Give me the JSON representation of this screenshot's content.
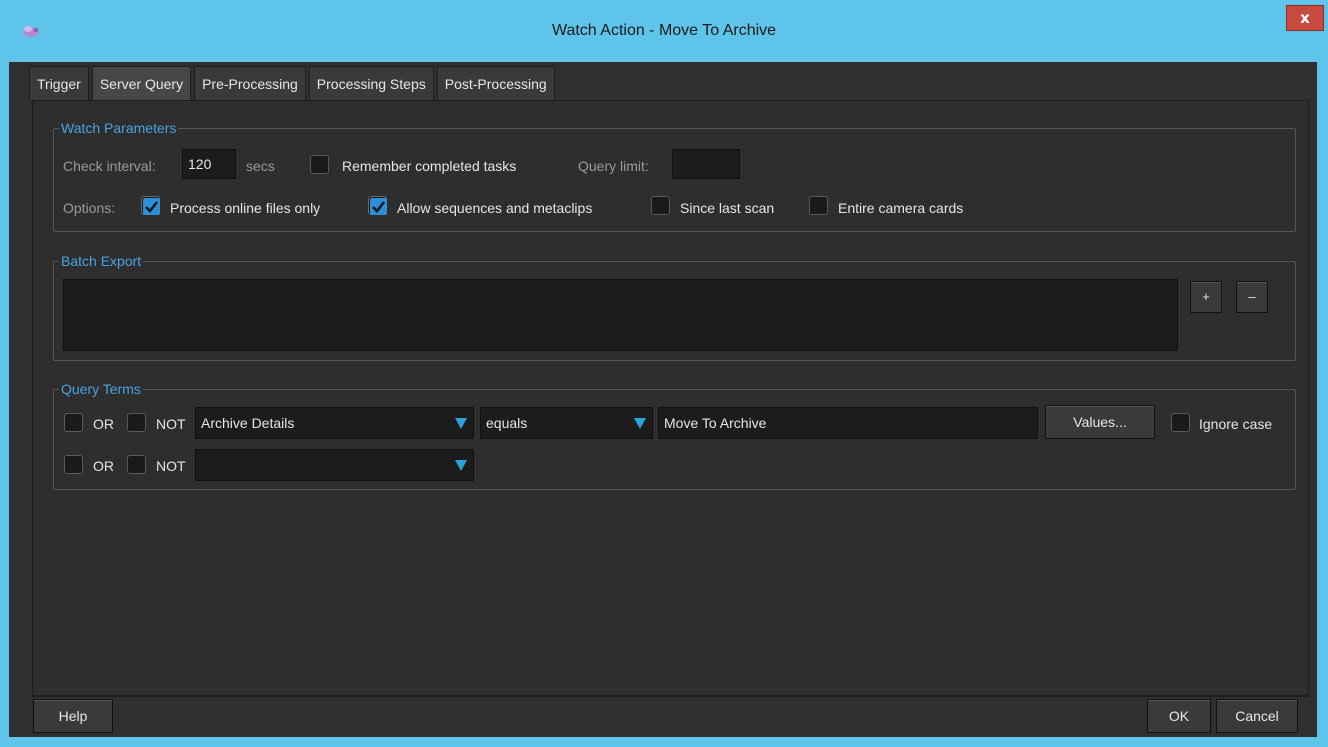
{
  "window": {
    "title": "Watch Action - Move To Archive",
    "close_label": "x"
  },
  "tabs": [
    {
      "label": "Trigger"
    },
    {
      "label": "Server Query"
    },
    {
      "label": "Pre-Processing"
    },
    {
      "label": "Processing Steps"
    },
    {
      "label": "Post-Processing"
    }
  ],
  "active_tab": "Server Query",
  "watch_parameters": {
    "title": "Watch Parameters",
    "check_interval_label": "Check interval:",
    "check_interval_value": "120",
    "secs_label": "secs",
    "remember_completed_label": "Remember completed tasks",
    "remember_completed_checked": false,
    "query_limit_label": "Query limit:",
    "query_limit_value": "",
    "options_label": "Options:",
    "options": [
      {
        "label": "Process online files only",
        "checked": true
      },
      {
        "label": "Allow sequences and metaclips",
        "checked": true
      },
      {
        "label": "Since last scan",
        "checked": false
      },
      {
        "label": "Entire camera cards",
        "checked": false
      }
    ]
  },
  "batch_export": {
    "title": "Batch Export",
    "add_label": "+",
    "remove_label": "–"
  },
  "query_terms": {
    "title": "Query Terms",
    "rows": [
      {
        "or_label": "OR",
        "or_checked": false,
        "not_label": "NOT",
        "not_checked": false,
        "field": "Archive Details",
        "operator": "equals",
        "value": "Move To Archive",
        "values_button": "Values...",
        "ignore_case_label": "Ignore case",
        "ignore_case_checked": false
      },
      {
        "or_label": "OR",
        "or_checked": false,
        "not_label": "NOT",
        "not_checked": false,
        "field": ""
      }
    ]
  },
  "footer": {
    "help_label": "Help",
    "ok_label": "OK",
    "cancel_label": "Cancel"
  },
  "colors": {
    "titlebar": "#5fc4ea",
    "panel": "#2e2e2e",
    "group_title": "#4aa3e0",
    "accent_arrow": "#2da4d9",
    "close_button": "#c74a3e"
  }
}
